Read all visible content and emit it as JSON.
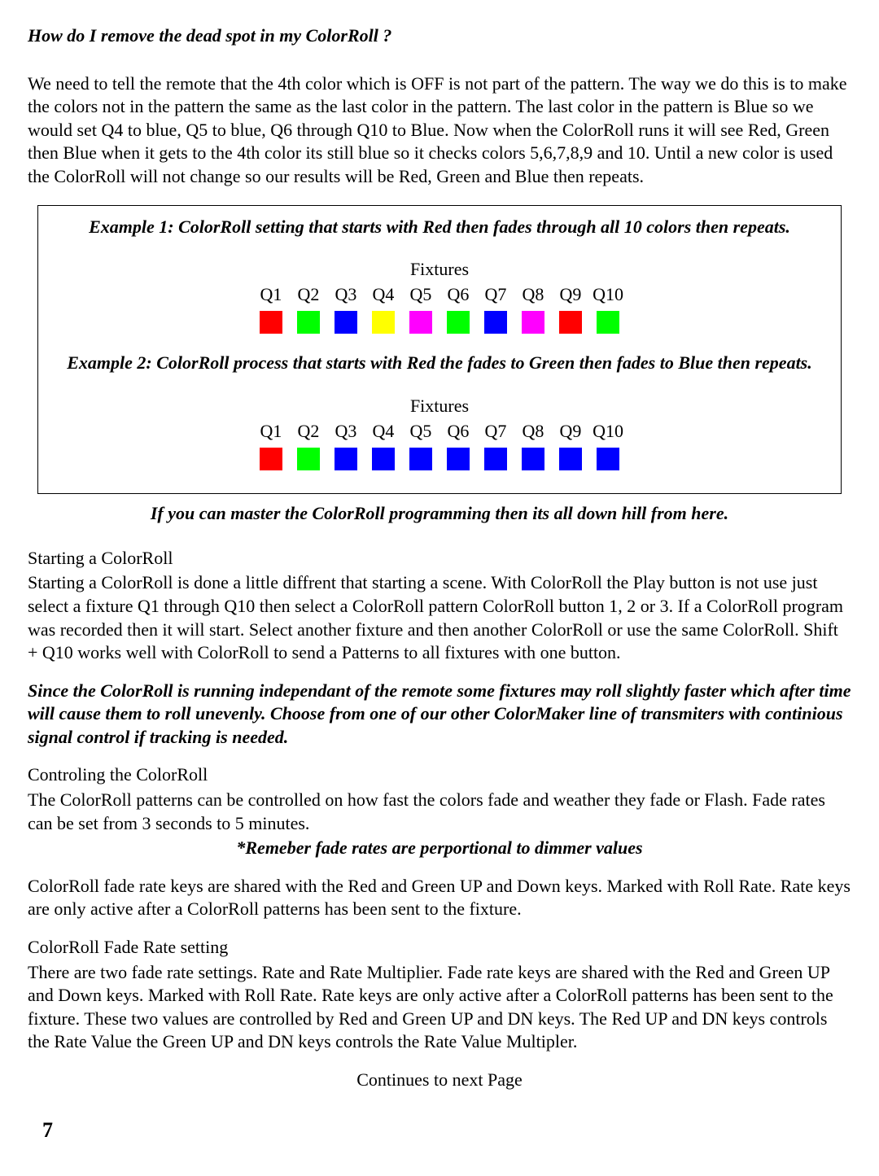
{
  "heading": "How do I remove the dead spot in my ColorRoll ?",
  "intro": "We need to tell the remote that the 4th color which is OFF is not part of the pattern. The way we do this is to make the colors not in the pattern the same as the last color in the pattern. The last color in the pattern is Blue so we would set Q4 to blue, Q5 to blue, Q6 through Q10 to Blue. Now when the ColorRoll runs it will see Red, Green then Blue when it gets to the 4th color its still blue so it checks colors 5,6,7,8,9 and 10. Until a new color is used the ColorRoll will not change so our results will be Red, Green and Blue then repeats.",
  "example1": {
    "title": "Example 1: ColorRoll setting that starts with Red then fades through all 10 colors then repeats.",
    "fixtures_label": "Fixtures",
    "q_labels": [
      "Q1",
      "Q2",
      "Q3",
      "Q4",
      "Q5",
      "Q6",
      "Q7",
      "Q8",
      "Q9",
      "Q10"
    ],
    "colors": [
      "#ff0000",
      "#00ff00",
      "#0000ff",
      "#ffff00",
      "#ff00ff",
      "#00ff00",
      "#0000ff",
      "#ff00ff",
      "#ff0000",
      "#00ff00"
    ]
  },
  "example2": {
    "title": "Example 2: ColorRoll process that starts with Red the fades to Green then fades to Blue then repeats.",
    "fixtures_label": "Fixtures",
    "q_labels": [
      "Q1",
      "Q2",
      "Q3",
      "Q4",
      "Q5",
      "Q6",
      "Q7",
      "Q8",
      "Q9",
      "Q10"
    ],
    "colors": [
      "#ff0000",
      "#00ff00",
      "#0000ff",
      "#0000ff",
      "#0000ff",
      "#0000ff",
      "#0000ff",
      "#0000ff",
      "#0000ff",
      "#0000ff"
    ]
  },
  "caption": "If you can master the ColorRoll programming then its all down hill from here.",
  "section_start": {
    "title": "Starting a ColorRoll",
    "body": "Starting a ColorRoll is done a little diffrent that starting a scene. With ColorRoll the Play button is not use just select a fixture Q1 through Q10 then select a ColorRoll pattern ColorRoll button 1, 2 or 3.  If a ColorRoll program was recorded then it will start. Select another fixture and then another ColorRoll or use the same ColorRoll.  Shift + Q10 works well with ColorRoll to send a Patterns to all fixtures with one button."
  },
  "independent_note": "Since the ColorRoll is running independant of the remote some fixtures may roll slightly faster which after time will cause them to roll unevenly. Choose from one of our other ColorMaker line of transmiters with continious signal control if tracking is needed.",
  "section_control": {
    "title": "Controling the ColorRoll",
    "body": "The ColorRoll patterns can be controlled on how fast the colors fade and weather they fade or Flash. Fade rates can be set from 3 seconds to 5 minutes."
  },
  "remember_note": "*Remeber fade rates are perportional to dimmer values",
  "fade_keys_para": "ColorRoll fade rate keys are shared with the Red and Green UP and Down keys. Marked with Roll Rate. Rate keys are only active after a ColorRoll patterns has been sent to the fixture.",
  "section_faderate": {
    "title": "ColorRoll Fade Rate setting",
    "body": "There are two fade rate settings. Rate and Rate Multiplier. Fade rate keys are shared with the Red and Green UP and Down keys. Marked with Roll Rate. Rate keys are only active after a ColorRoll patterns has been sent to the fixture. These two values are controlled by Red and Green UP and DN keys. The Red UP and DN keys controls the Rate Value the Green UP and DN keys controls the Rate Value Multipler."
  },
  "continues": "Continues to next Page",
  "page_number": "7"
}
